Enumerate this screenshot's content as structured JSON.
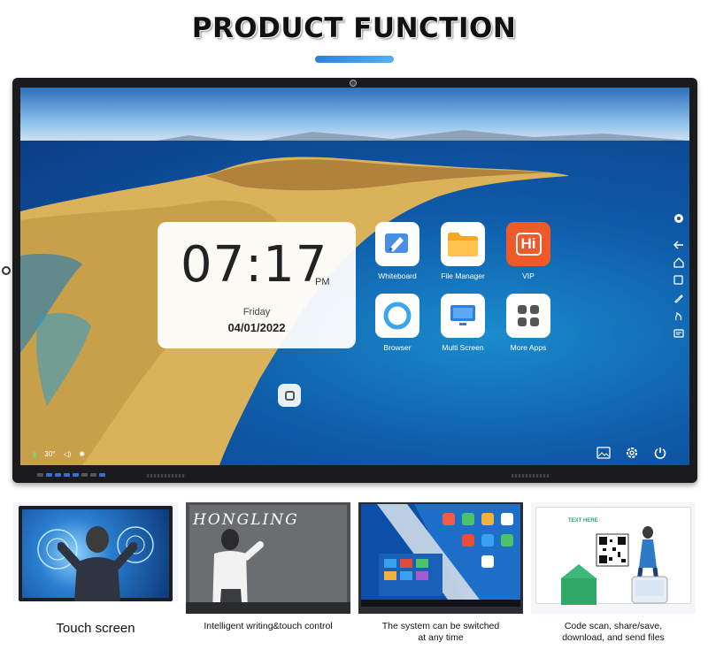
{
  "headline": "PRODUCT FUNCTION",
  "clock": {
    "time": "07:17",
    "ampm": "PM",
    "day": "Friday",
    "date": "04/01/2022"
  },
  "apps": [
    {
      "label": "Whiteboard",
      "icon": "whiteboard-icon"
    },
    {
      "label": "File Manager",
      "icon": "folder-icon"
    },
    {
      "label": "VIP",
      "icon": "vip-hi-icon",
      "icon_text": "Hi"
    },
    {
      "label": "Browser",
      "icon": "browser-icon"
    },
    {
      "label": "Multi Screen",
      "icon": "multi-screen-icon"
    },
    {
      "label": "More Apps",
      "icon": "more-apps-icon"
    }
  ],
  "status": {
    "temperature": "30°"
  },
  "features": [
    {
      "caption": "Touch screen"
    },
    {
      "caption": "Intelligent writing&touch control",
      "board_text": "HONGLING"
    },
    {
      "caption": "The system can be switched at any time"
    },
    {
      "caption": "Code scan, share/save, download, and send files",
      "card_text": "TEXT HERE"
    }
  ],
  "colors": {
    "accent_bar": "#3b8fe6",
    "vip_orange": "#f05a28",
    "folder_orange": "#f5a623"
  }
}
